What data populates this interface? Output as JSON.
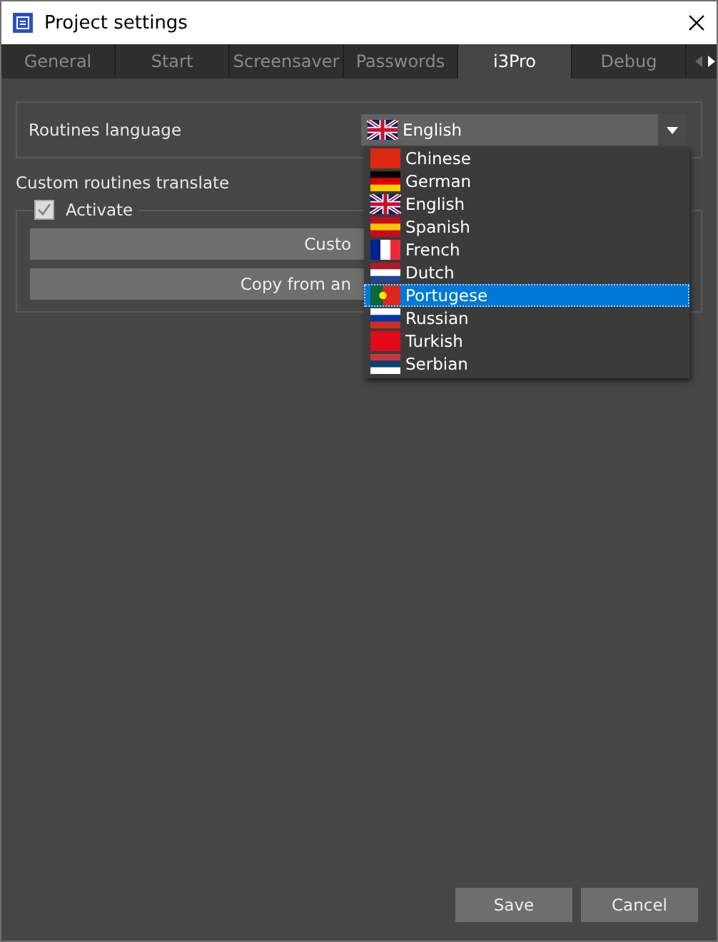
{
  "window": {
    "title": "Project settings"
  },
  "tabs": [
    {
      "label": "General",
      "selected": false
    },
    {
      "label": "Start",
      "selected": false
    },
    {
      "label": "Screensaver",
      "selected": false
    },
    {
      "label": "Passwords",
      "selected": false
    },
    {
      "label": "i3Pro",
      "selected": true
    },
    {
      "label": "Debug",
      "selected": false
    }
  ],
  "routines_language": {
    "label": "Routines language",
    "value": "English",
    "expanded": true,
    "options": [
      {
        "label": "Chinese",
        "highlighted": false
      },
      {
        "label": "German",
        "highlighted": false
      },
      {
        "label": "English",
        "highlighted": false
      },
      {
        "label": "Spanish",
        "highlighted": false
      },
      {
        "label": "French",
        "highlighted": false
      },
      {
        "label": "Dutch",
        "highlighted": false
      },
      {
        "label": "Portugese",
        "highlighted": true
      },
      {
        "label": "Russian",
        "highlighted": false
      },
      {
        "label": "Turkish",
        "highlighted": false
      },
      {
        "label": "Serbian",
        "highlighted": false
      }
    ]
  },
  "custom_translate": {
    "title": "Custom routines translate",
    "activate": {
      "label": "Activate",
      "checked": true
    },
    "buttons": [
      "Custo",
      "Copy from an"
    ]
  },
  "footer_buttons": [
    "Save",
    "Cancel"
  ]
}
